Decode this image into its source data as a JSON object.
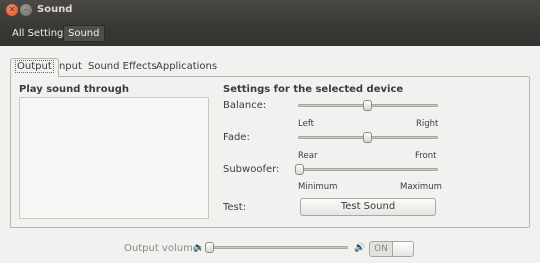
{
  "window": {
    "title": "Sound"
  },
  "toolbar": {
    "all_settings": "All Settings",
    "current": "Sound"
  },
  "tabs": [
    {
      "label": "Output",
      "active": true
    },
    {
      "label": "Input"
    },
    {
      "label": "Sound Effects"
    },
    {
      "label": "Applications"
    }
  ],
  "output": {
    "play_through_title": "Play sound through",
    "device_settings_title": "Settings for the selected device",
    "balance": {
      "label": "Balance:",
      "left": "Left",
      "right": "Right",
      "value": 0.5
    },
    "fade": {
      "label": "Fade:",
      "rear": "Rear",
      "front": "Front",
      "value": 0.5
    },
    "subwoofer": {
      "label": "Subwoofer:",
      "min": "Minimum",
      "max": "Maximum",
      "value": 0.0
    },
    "test": {
      "label": "Test:",
      "button": "Test Sound"
    }
  },
  "footer": {
    "volume_label": "Output volume:",
    "volume_value": 0.0,
    "on_label": "ON"
  },
  "icons": {
    "close": "close-icon",
    "minimize": "minimize-icon",
    "speaker_low": "speaker-low-icon",
    "speaker_high": "speaker-high-icon"
  }
}
